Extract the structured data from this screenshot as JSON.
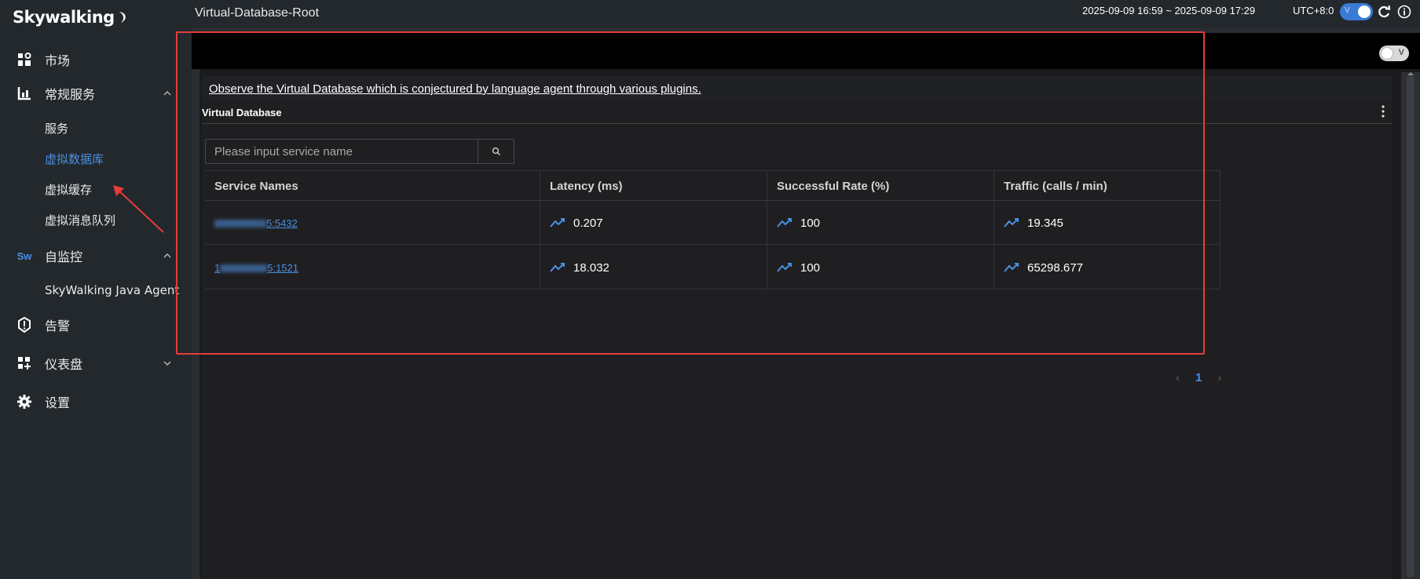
{
  "brand": {
    "name": "Skywalking"
  },
  "sidebar": {
    "items": [
      {
        "label": "市场",
        "icon": "marketplace-icon"
      },
      {
        "label": "常规服务",
        "icon": "chart-icon",
        "expanded": true
      },
      {
        "label": "服务"
      },
      {
        "label": "虚拟数据库",
        "active": true
      },
      {
        "label": "虚拟缓存"
      },
      {
        "label": "虚拟消息队列"
      },
      {
        "label": "自监控",
        "icon": "sw-icon",
        "expanded": true
      },
      {
        "label": "SkyWalking Java Agent"
      },
      {
        "label": "告警",
        "icon": "alert-icon"
      },
      {
        "label": "仪表盘",
        "icon": "dashboard-icon",
        "expanded": false
      },
      {
        "label": "设置",
        "icon": "gear-icon"
      }
    ],
    "sw_badge": "Sw"
  },
  "header": {
    "title": "Virtual-Database-Root",
    "time_range": "2025-09-09 16:59 ~ 2025-09-09 17:29",
    "timezone": "UTC+8:0",
    "toggle_label": "V",
    "corner_toggle_label": "V"
  },
  "main": {
    "description": "Observe the Virtual Database which is conjectured by language agent through various plugins.",
    "card_title": "Virtual Database",
    "search": {
      "placeholder": "Please input service name",
      "value": ""
    },
    "table": {
      "columns": [
        "Service Names",
        "Latency (ms)",
        "Successful Rate (%)",
        "Traffic (calls / min)"
      ],
      "rows": [
        {
          "service": "5:5432",
          "latency": "0.207",
          "success_rate": "100",
          "traffic": "19.345"
        },
        {
          "service": "1",
          "service_tail": "5:1521",
          "latency": "18.032",
          "success_rate": "100",
          "traffic": "65298.677"
        }
      ]
    },
    "pagination": {
      "prev": "‹",
      "current": "1",
      "next": "›"
    }
  },
  "colors": {
    "accent": "#4a90e2",
    "highlight_border": "#e83b3b",
    "sidebar_bg": "#23282d",
    "main_bg": "#1b1b1d"
  }
}
